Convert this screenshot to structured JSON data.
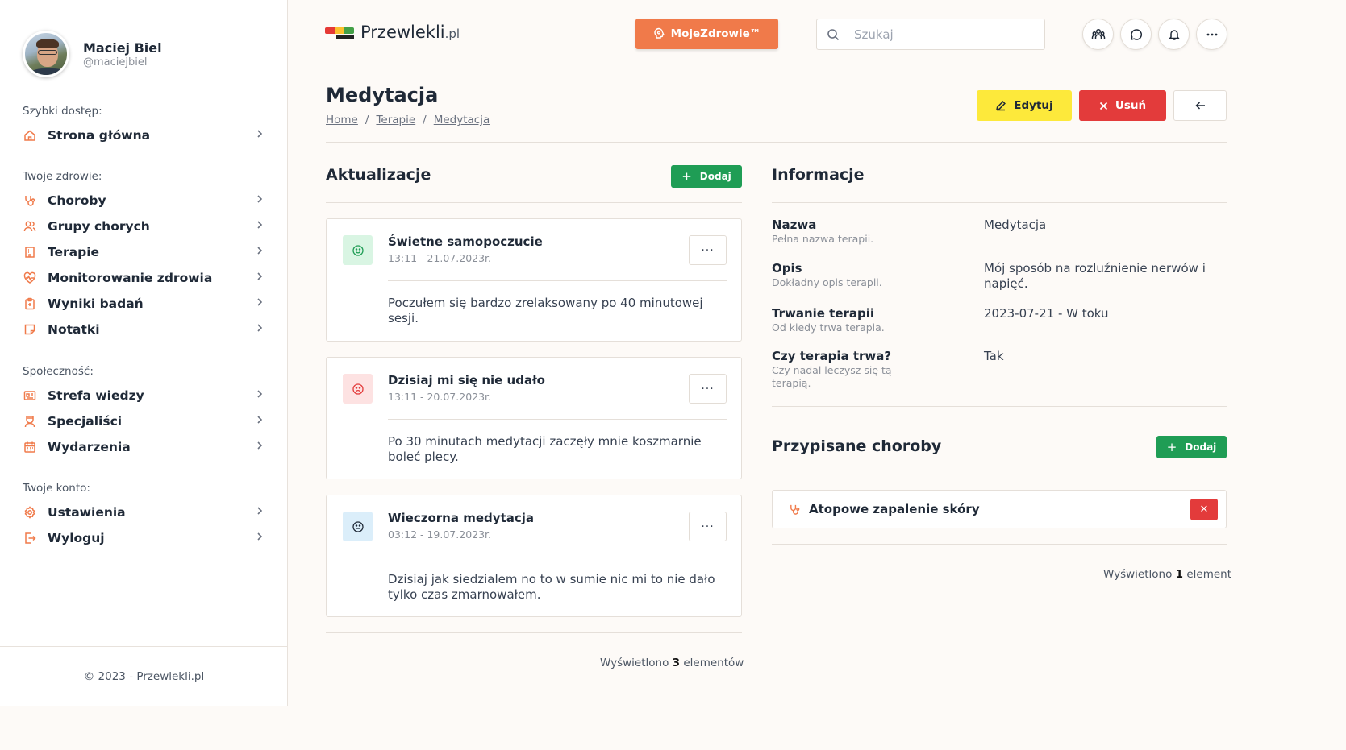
{
  "user": {
    "name": "Maciej Biel",
    "handle": "@maciejbiel"
  },
  "sidebar": {
    "sections": [
      {
        "heading": "Szybki dostęp:",
        "items": [
          {
            "label": "Strona główna",
            "icon": "home-icon"
          }
        ]
      },
      {
        "heading": "Twoje zdrowie:",
        "items": [
          {
            "label": "Choroby",
            "icon": "stethoscope-icon"
          },
          {
            "label": "Grupy chorych",
            "icon": "users-icon"
          },
          {
            "label": "Terapie",
            "icon": "building-icon"
          },
          {
            "label": "Monitorowanie zdrowia",
            "icon": "heart-pulse-icon"
          },
          {
            "label": "Wyniki badań",
            "icon": "clipboard-icon"
          },
          {
            "label": "Notatki",
            "icon": "note-icon"
          }
        ]
      },
      {
        "heading": "Społeczność:",
        "items": [
          {
            "label": "Strefa wiedzy",
            "icon": "newspaper-icon"
          },
          {
            "label": "Specjaliści",
            "icon": "doctor-icon"
          },
          {
            "label": "Wydarzenia",
            "icon": "calendar-icon"
          }
        ]
      },
      {
        "heading": "Twoje konto:",
        "items": [
          {
            "label": "Ustawienia",
            "icon": "gear-icon"
          },
          {
            "label": "Wyloguj",
            "icon": "logout-icon"
          }
        ]
      }
    ],
    "footer": "© 2023 - Przewlekli.pl"
  },
  "topbar": {
    "logo_main": "Przewlekli",
    "logo_suffix": ".pl",
    "moje_button": "MojeZdrowie™",
    "search_placeholder": "Szukaj"
  },
  "page": {
    "title": "Medytacja",
    "breadcrumb": [
      "Home",
      "Terapie",
      "Medytacja"
    ],
    "edit_label": "Edytuj",
    "delete_label": "Usuń"
  },
  "updates": {
    "title": "Aktualizacje",
    "add_label": "Dodaj",
    "items": [
      {
        "title": "Świetne samopoczucie",
        "date": "13:11 - 21.07.2023r.",
        "body": "Poczułem się bardzo zrelaksowany po 40 minutowej sesji.",
        "mood": "happy"
      },
      {
        "title": "Dzisiaj mi się nie udało",
        "date": "13:11 - 20.07.2023r.",
        "body": "Po 30 minutach medytacji zaczęły mnie koszmarnie boleć plecy.",
        "mood": "sad"
      },
      {
        "title": "Wieczorna medytacja",
        "date": "03:12 - 19.07.2023r.",
        "body": "Dzisiaj jak siedzialem no to w sumie nic mi to nie dało tylko czas zmarnowałem.",
        "mood": "neutral"
      }
    ],
    "count_prefix": "Wyświetlono",
    "count_value": "3",
    "count_suffix": "elementów"
  },
  "info": {
    "title": "Informacje",
    "rows": [
      {
        "label": "Nazwa",
        "desc": "Pełna nazwa terapii.",
        "value": "Medytacja"
      },
      {
        "label": "Opis",
        "desc": "Dokładny opis terapii.",
        "value": "Mój sposób na rozluźnienie nerwów i napięć."
      },
      {
        "label": "Trwanie terapii",
        "desc": "Od kiedy trwa terapia.",
        "value": "2023-07-21 - W toku"
      },
      {
        "label": "Czy terapia trwa?",
        "desc": "Czy nadal leczysz się tą terapią.",
        "value": "Tak"
      }
    ]
  },
  "diseases": {
    "title": "Przypisane choroby",
    "add_label": "Dodaj",
    "items": [
      {
        "label": "Atopowe zapalenie skóry"
      }
    ],
    "count_prefix": "Wyświetlono",
    "count_value": "1",
    "count_suffix": "element"
  },
  "colors": {
    "accent": "#f07a4a",
    "edit": "#fde93b",
    "delete": "#e33b3b",
    "add": "#1f9d55",
    "mood_happy_bg": "#d9f5e3",
    "mood_sad_bg": "#fde2e2",
    "mood_neutral_bg": "#dbeefa"
  }
}
